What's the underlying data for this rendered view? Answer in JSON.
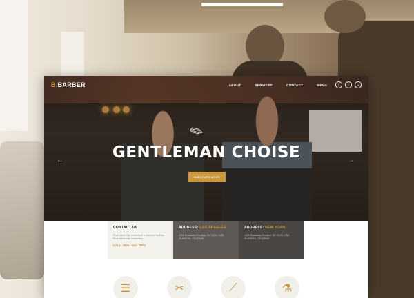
{
  "brand": {
    "logo_prefix": "B.",
    "logo_name": "BARBER",
    "accent_color": "#c9963b"
  },
  "nav": {
    "links": [
      "ABOUT",
      "SERVICES",
      "CONTACT",
      "MENU"
    ],
    "socials": [
      "f",
      "t",
      "o"
    ]
  },
  "hero": {
    "title": "GENTLEMAN CHOISE",
    "button_label": "DISCOVER MORE",
    "prev_arrow": "←",
    "next_arrow": "→",
    "icon": "razor-icon"
  },
  "info": {
    "contact": {
      "heading": "CONTACT US",
      "text": "Proin lorem nisl, fermentum in interdum facilisis. Proin lorem nisl, fermentum.",
      "phone": "CALL: 7800 · 614 · 8803"
    },
    "la": {
      "heading_prefix": "ADDRESS:",
      "heading_city": "LOS ANGELES",
      "text": "1006 Broadway Brooklyn, NY 11221, USA 40.690744, -73.922626"
    },
    "ny": {
      "heading_prefix": "ADDRESS:",
      "heading_city": "NEW YORK",
      "text": "1006 Broadway Brooklyn, NY 11221, USA 40.690744, -73.922626"
    }
  },
  "services": [
    {
      "icon": "comb-icon",
      "glyph": "☰"
    },
    {
      "icon": "scissors-icon",
      "glyph": "✂"
    },
    {
      "icon": "razor-icon",
      "glyph": "⟋"
    },
    {
      "icon": "spray-bottle-icon",
      "glyph": "⚗"
    }
  ]
}
